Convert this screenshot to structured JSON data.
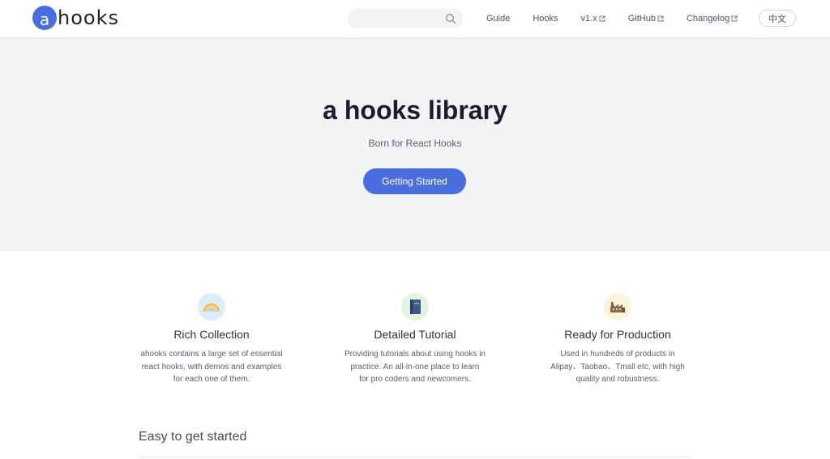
{
  "header": {
    "logo_letter": "a",
    "logo_text": "hooks",
    "search": {
      "placeholder": ""
    },
    "nav": [
      {
        "label": "Guide",
        "external": false
      },
      {
        "label": "Hooks",
        "external": false
      },
      {
        "label": "v1.x",
        "external": true
      },
      {
        "label": "GitHub",
        "external": true
      },
      {
        "label": "Changelog",
        "external": true
      }
    ],
    "language_label": "中文"
  },
  "hero": {
    "title": "a hooks library",
    "subtitle": "Born for React Hooks",
    "cta_label": "Getting Started"
  },
  "features": [
    {
      "icon": "rainbow-icon",
      "title": "Rich Collection",
      "desc_lines": [
        "ahooks contains a large set of essential",
        "react hooks, with demos and examples",
        "for each one of them."
      ]
    },
    {
      "icon": "notebook-icon",
      "title": "Detailed Tutorial",
      "desc_lines": [
        "Providing tutorials about using hooks in",
        "practice. An all-in-one place to learn",
        "for pro coders and newcomers."
      ]
    },
    {
      "icon": "factory-icon",
      "title": "Ready for Production",
      "desc_lines": [
        "Used in hundreds of products in",
        "Alipay、Taobao、Tmall etc, with high",
        "quality and robustness."
      ]
    }
  ],
  "section": {
    "title": "Easy to get started"
  },
  "colors": {
    "accent": "#4a6ee0",
    "hero_bg": "#f2f3f5"
  }
}
